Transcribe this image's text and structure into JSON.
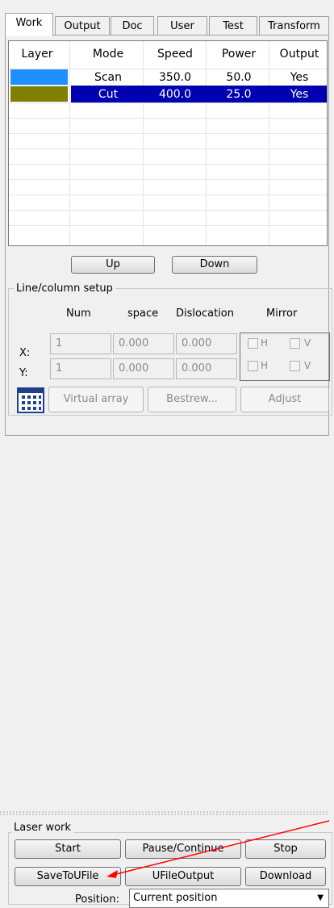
{
  "tabs": [
    {
      "label": "Work"
    },
    {
      "label": "Output"
    },
    {
      "label": "Doc"
    },
    {
      "label": "User"
    },
    {
      "label": "Test"
    },
    {
      "label": "Transform"
    }
  ],
  "layer_table": {
    "headers": [
      "Layer",
      "Mode",
      "Speed",
      "Power",
      "Output"
    ],
    "rows": [
      {
        "color": "#1e90ff",
        "mode": "Scan",
        "speed": "350.0",
        "power": "50.0",
        "output": "Yes",
        "selected": false
      },
      {
        "color": "#808000",
        "mode": "Cut",
        "speed": "400.0",
        "power": "25.0",
        "output": "Yes",
        "selected": true
      }
    ]
  },
  "buttons": {
    "up": "Up",
    "down": "Down"
  },
  "line_setup": {
    "title": "Line/column setup",
    "col_num": "Num",
    "col_space": "space",
    "col_dislocation": "Dislocation",
    "col_mirror": "Mirror",
    "x_label": "X:",
    "y_label": "Y:",
    "x_num": "1",
    "x_space": "0.000",
    "x_dislocation": "0.000",
    "y_num": "1",
    "y_space": "0.000",
    "y_dislocation": "0.000",
    "mirror_h": "H",
    "mirror_v": "V",
    "virtual_array": "Virtual array",
    "bestrew": "Bestrew...",
    "adjust": "Adjust"
  },
  "laser_work": {
    "title": "Laser work",
    "start": "Start",
    "pause": "Pause/Continue",
    "stop": "Stop",
    "save_to_ufile": "SaveToUFile",
    "ufile_output": "UFileOutput",
    "download": "Download",
    "position_label": "Position:",
    "position_value": "Current position"
  },
  "colors": {
    "selection": "#0000b0",
    "annotation_arrow": "#ff0000"
  }
}
